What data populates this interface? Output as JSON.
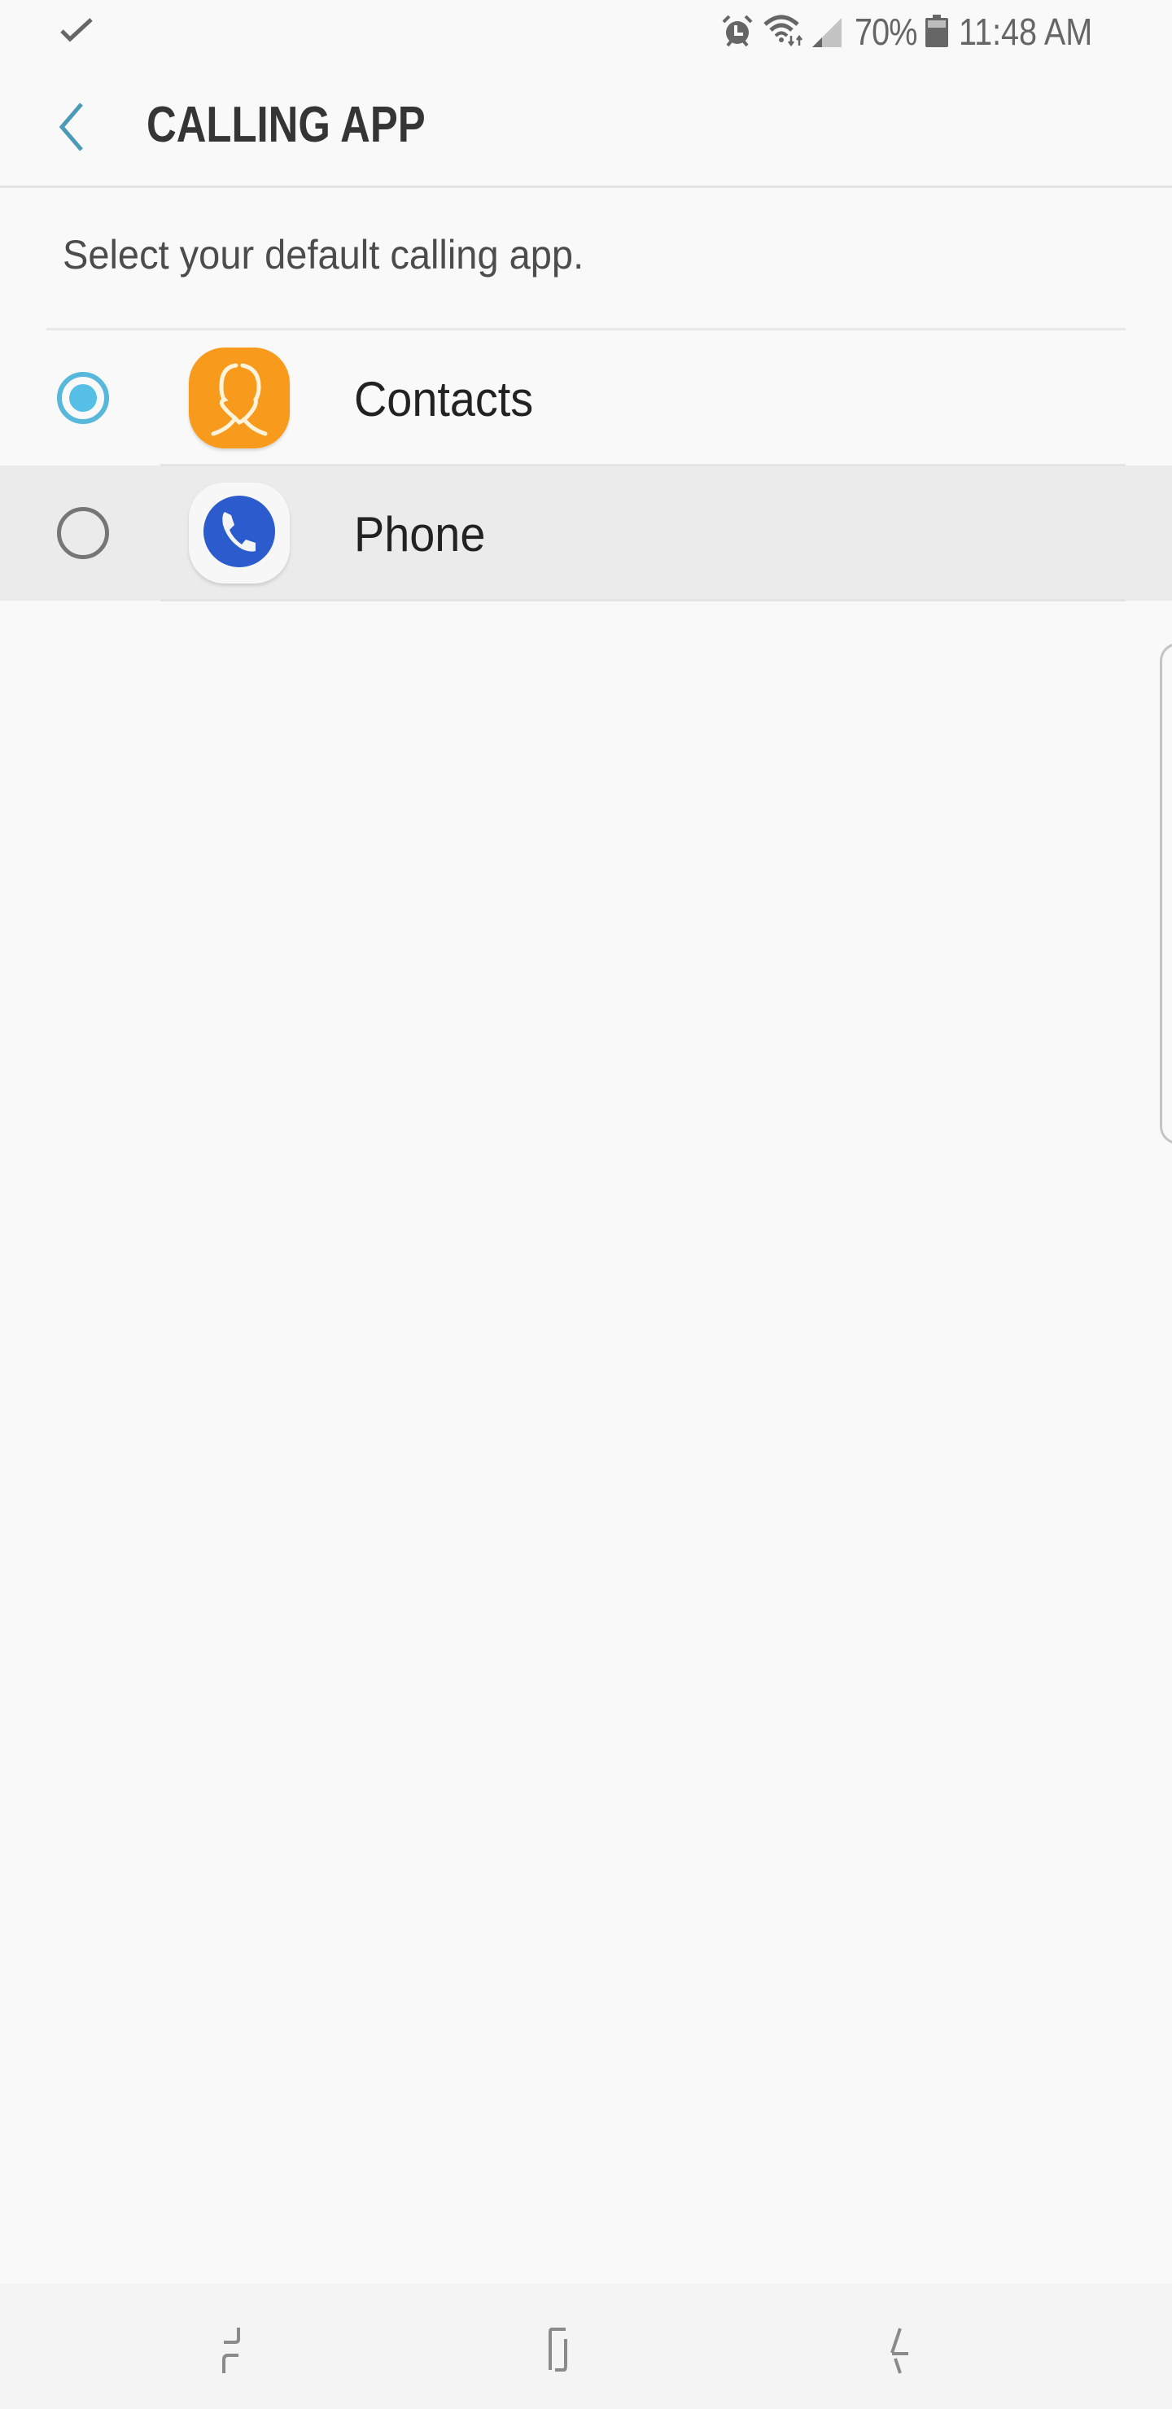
{
  "status_bar": {
    "notification_icon": "check-icon",
    "icons": [
      "alarm-icon",
      "wifi-icon",
      "signal-icon",
      "battery-icon"
    ],
    "battery_percent": "70%",
    "time": "11:48 AM"
  },
  "header": {
    "back_icon": "chevron-left-icon",
    "title": "CALLING APP"
  },
  "subtitle": "Select your default calling app.",
  "apps": [
    {
      "label": "Contacts",
      "icon": "contacts-icon",
      "selected": true,
      "icon_color": "#f89b1c"
    },
    {
      "label": "Phone",
      "icon": "phone-icon",
      "selected": false,
      "icon_color": "#2b5bcc"
    }
  ],
  "colors": {
    "accent": "#57b8dc",
    "title": "#353535",
    "highlight_row": "#ebebeb",
    "background": "#f9f9f9"
  },
  "nav_bar": {
    "buttons": [
      "recents-icon",
      "home-icon",
      "back-icon"
    ]
  }
}
